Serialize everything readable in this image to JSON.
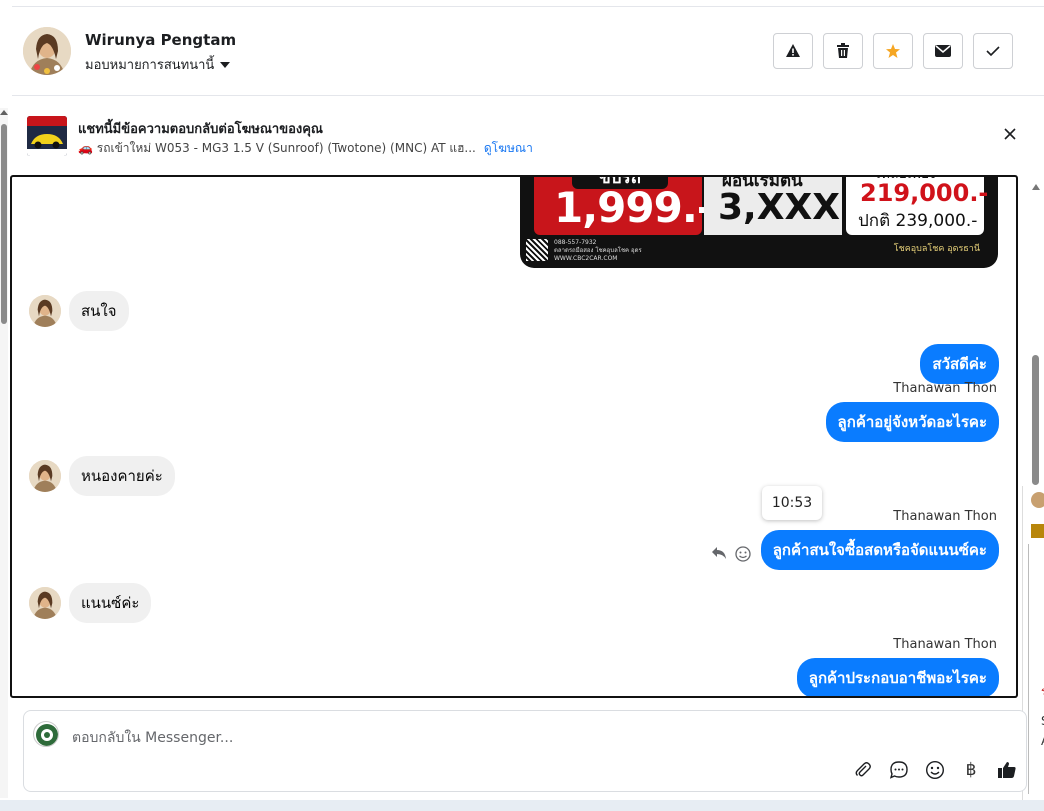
{
  "header": {
    "contact_name": "Wirunya Pengtam",
    "assign_label": "มอบหมายการสนทนานี้",
    "actions": [
      {
        "name": "report-button",
        "icon": "warning-icon"
      },
      {
        "name": "delete-button",
        "icon": "trash-icon"
      },
      {
        "name": "star-button",
        "icon": "star-icon",
        "color": "#f5a623"
      },
      {
        "name": "mark-unread-button",
        "icon": "envelope-icon"
      },
      {
        "name": "mark-done-button",
        "icon": "check-icon"
      }
    ]
  },
  "ad_context": {
    "title": "แชทนี้มีข้อความตอบกลับต่อโฆษณาของคุณ",
    "ad_name": "🚗 รถเข้าใหม่ W053 - MG3 1.5 V (Sunroof) (Twotone) (MNC) AT แฮ...",
    "view_ad_link": "ดูโฆษณา"
  },
  "banner": {
    "tag": "ขับรถ",
    "down_payment": "1,999.-",
    "installment_label": "ผ่อนเริ่มต้น",
    "installment": "3,XXX.-",
    "remaining_label": "เหลือเพียง",
    "price": "219,000.-",
    "normal_price": "ปกติ 239,000.-",
    "phone": "088-557-7932",
    "facebook": "ตลาดรถมือสอง โชคอุบลโชค อุดร",
    "website": "WWW.CBC2CAR.COM",
    "dealer_logo": "โชคอุบลโชค อุดรธานี"
  },
  "messages": [
    {
      "dir": "in",
      "text": "สนใจ"
    },
    {
      "dir": "out",
      "text": "สวัสดีค่ะ"
    },
    {
      "dir": "out",
      "sender": "Thanawan Thon",
      "text": "ลูกค้าอยู่จังหวัดอะไรคะ"
    },
    {
      "dir": "in",
      "text": "หนองคายค่ะ"
    },
    {
      "dir": "out",
      "sender": "Thanawan Thon",
      "text": "ลูกค้าสนใจซื้อสดหรือจัดแนนซ์คะ",
      "hover_time": "10:53"
    },
    {
      "dir": "in",
      "text": "แนนซ์ค่ะ"
    },
    {
      "dir": "out",
      "sender": "Thanawan Thon",
      "text": "ลูกค้าประกอบอาชีพอะไรคะ"
    }
  ],
  "side_peek": {
    "frag1": "ร",
    "frag2": "S",
    "frag3": "A"
  },
  "composer": {
    "placeholder": "ตอบกลับใน Messenger...",
    "tools": [
      "paperclip-icon",
      "chat-bubble-icon",
      "emoji-icon",
      "baht-icon",
      "thumbs-up-icon"
    ],
    "baht_symbol": "฿"
  },
  "colors": {
    "accent": "#0a7cff",
    "star": "#f5a623",
    "banner_red": "#c8151b"
  }
}
